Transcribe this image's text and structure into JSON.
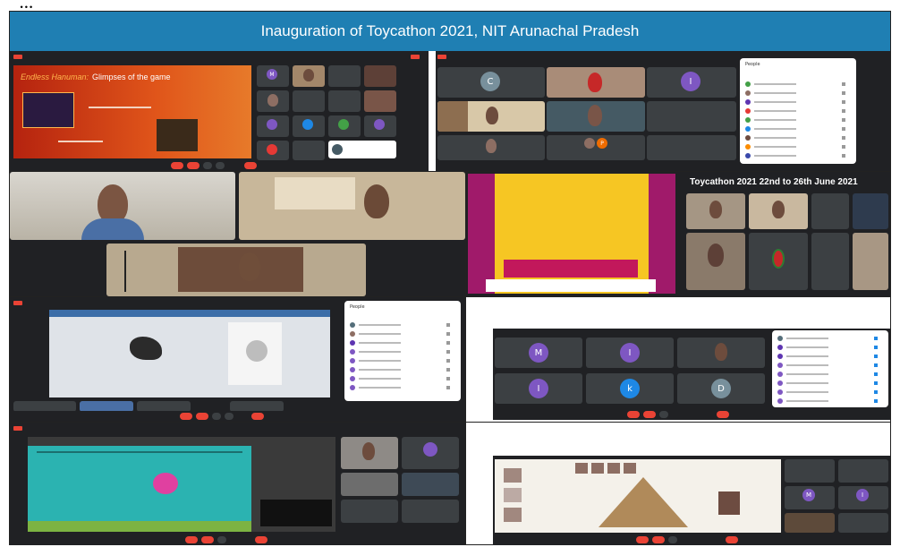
{
  "caption": "...",
  "banner": {
    "title": "Inauguration of Toycathon 2021, NIT Arunachal Pradesh",
    "bg": "#1f7fb3"
  },
  "slide": {
    "title_accent": "Endless Hanuman:",
    "title_rest": " Glimpses of the game"
  },
  "schedule_title": "Toycathon 2021 22nd to 26th June 2021",
  "people_label": "People",
  "tile_initials": [
    "C",
    "I",
    "M",
    "I",
    "k",
    "D",
    "I",
    "M",
    "P"
  ],
  "colors": {
    "meet_bg": "#202124",
    "tile_bg": "#3c4043",
    "accent_red": "#ea4335",
    "slide_orange": "#e0551a",
    "poster_yellow": "#f6c623",
    "teal_screen": "#2bb3b1"
  },
  "icons": [
    "mic-icon",
    "camera-icon",
    "hangup-icon",
    "captions-icon",
    "present-icon",
    "more-icon",
    "people-icon",
    "chat-icon"
  ]
}
